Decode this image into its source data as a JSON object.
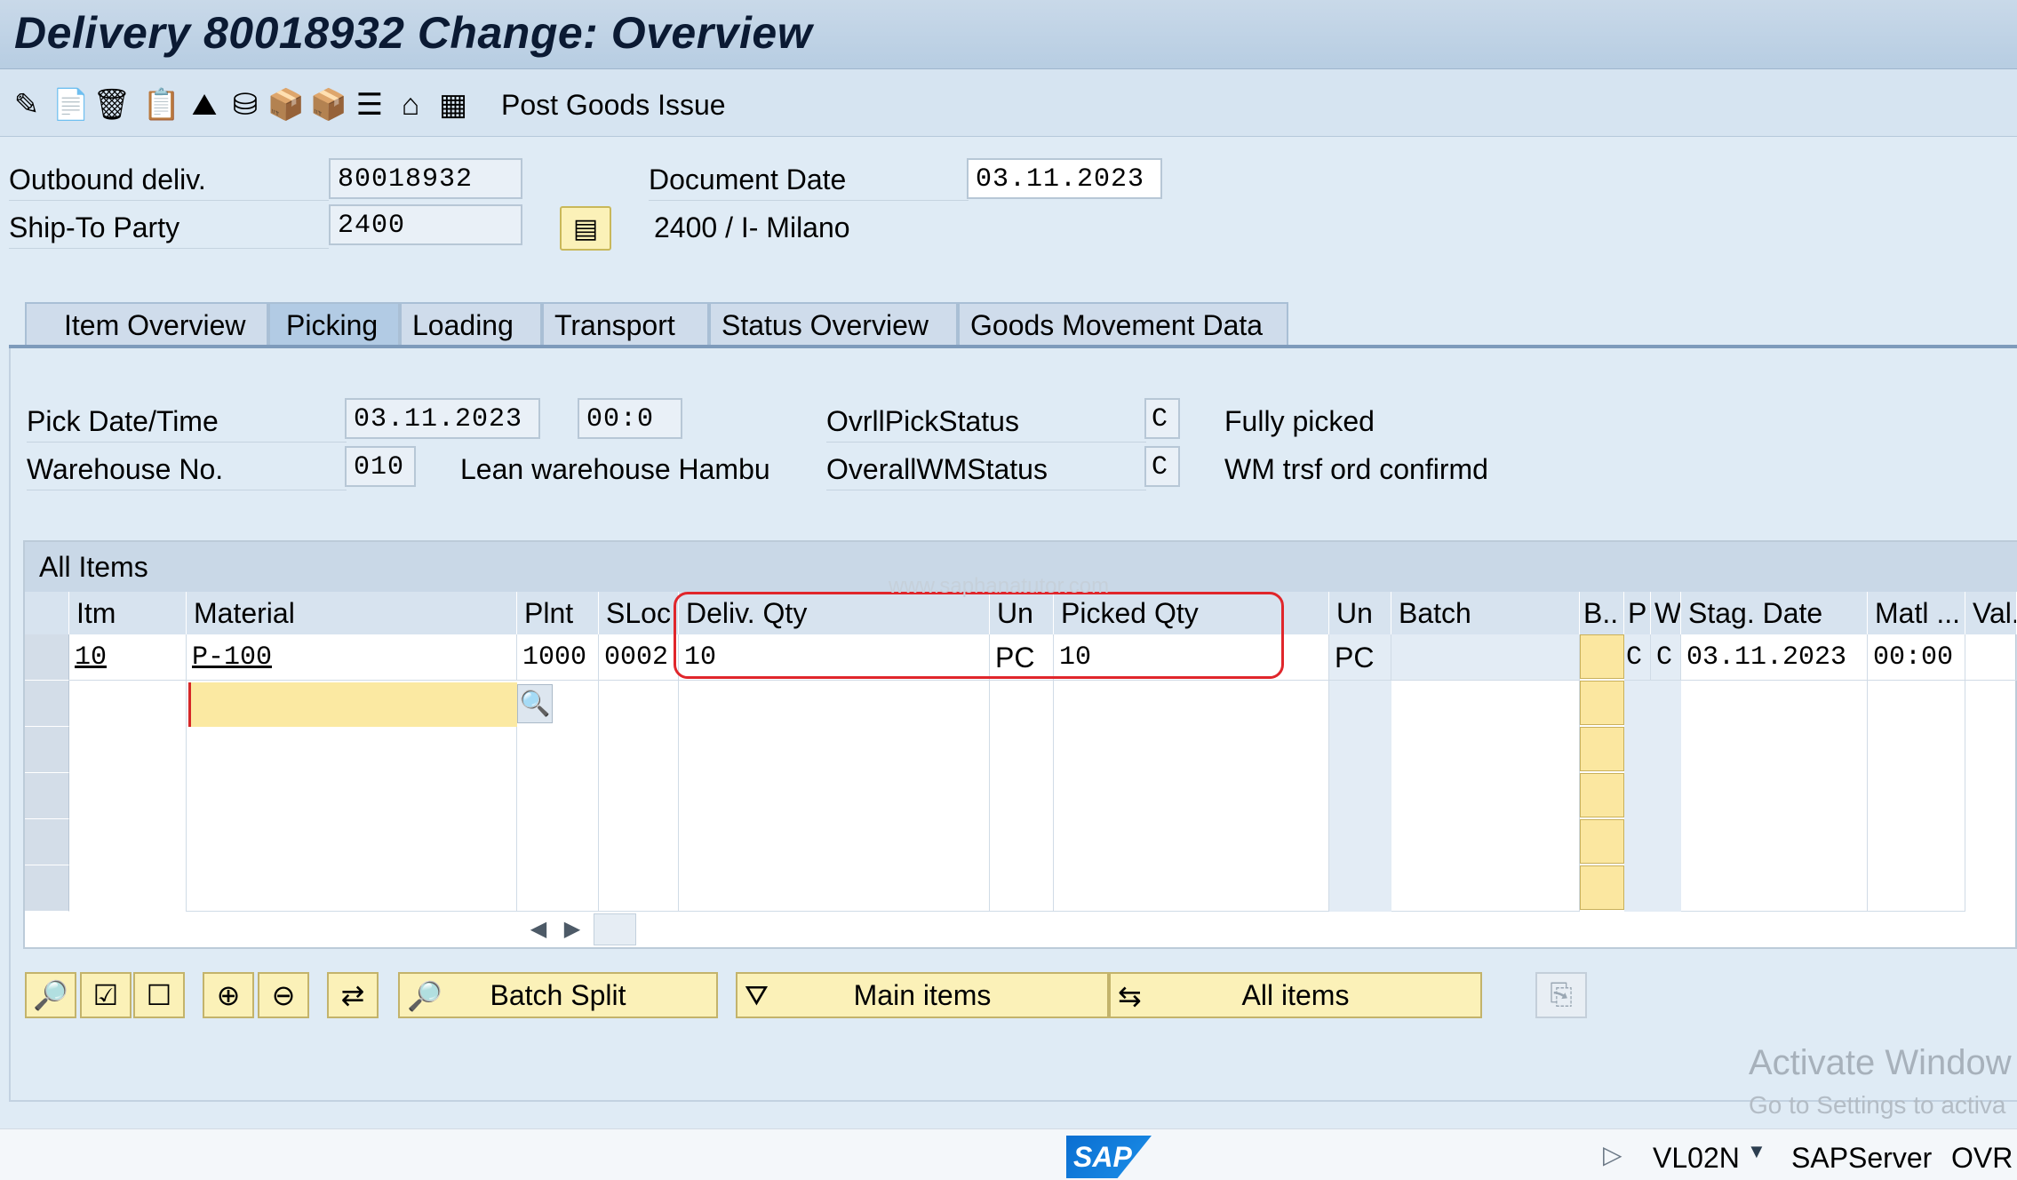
{
  "window": {
    "title": "Delivery 80018932 Change: Overview"
  },
  "toolbar": {
    "icons": [
      "edit-glasses-icon",
      "new-document-icon",
      "delete-icon",
      "copy-document-icon",
      "mountain-icon",
      "stamp-icon",
      "shipping-icon",
      "package-icon",
      "list-icon",
      "house-icon",
      "grid-icon"
    ],
    "post_goods_issue": "Post Goods Issue"
  },
  "header": {
    "outbound_label": "Outbound deliv.",
    "outbound_value": "80018932",
    "ship_to_label": "Ship-To Party",
    "ship_to_value": "2400",
    "document_date_label": "Document Date",
    "document_date_value": "03.11.2023",
    "ship_to_desc": "2400 / I- Milano"
  },
  "tabs": [
    {
      "label": "Item Overview"
    },
    {
      "label": "Picking"
    },
    {
      "label": "Loading"
    },
    {
      "label": "Transport"
    },
    {
      "label": "Status Overview"
    },
    {
      "label": "Goods Movement Data"
    }
  ],
  "picking": {
    "pick_date_label": "Pick Date/Time",
    "pick_date_value": "03.11.2023",
    "pick_time_value": "00:0",
    "warehouse_label": "Warehouse No.",
    "warehouse_value": "010",
    "warehouse_desc": "Lean warehouse Hambu",
    "ovrl_pick_label": "OvrllPickStatus",
    "ovrl_pick_value": "C",
    "ovrl_pick_desc": "Fully picked",
    "ovrl_wm_label": "OverallWMStatus",
    "ovrl_wm_value": "C",
    "ovrl_wm_desc": "WM trsf ord confirmd"
  },
  "table": {
    "caption": "All Items",
    "watermark": "www.saphanatutor.com",
    "headers": {
      "itm": "Itm",
      "material": "Material",
      "plnt": "Plnt",
      "sloc": "SLoc",
      "deliv_qty": "Deliv. Qty",
      "un1": "Un",
      "picked_qty": "Picked Qty",
      "un2": "Un",
      "batch": "Batch",
      "b": "B..",
      "p": "P",
      "w": "W",
      "stag_date": "Stag. Date",
      "matl": "Matl ...",
      "val": "Val."
    },
    "row1": {
      "itm": "10",
      "material": "P-100",
      "plnt": "1000",
      "sloc": "0002",
      "deliv_qty": "10",
      "un1": "PC",
      "picked_qty": "10",
      "un2": "PC",
      "p": "C",
      "w": "C",
      "stag_date": "03.11.2023",
      "matl": "00:00"
    }
  },
  "buttons": {
    "batch_split": "Batch Split",
    "main_items": "Main items",
    "all_items": "All items"
  },
  "statusbar": {
    "tcode": "VL02N",
    "server": "SAPServer",
    "mode": "OVR",
    "sap_logo": "SAP"
  },
  "windows_watermark": {
    "line1": "Activate Window",
    "line2": "Go to Settings to activa"
  },
  "colors": {
    "accent_yellow": "#fbf1b8",
    "highlight_red": "#e0262b",
    "title_bg": "#c9d9e9"
  }
}
